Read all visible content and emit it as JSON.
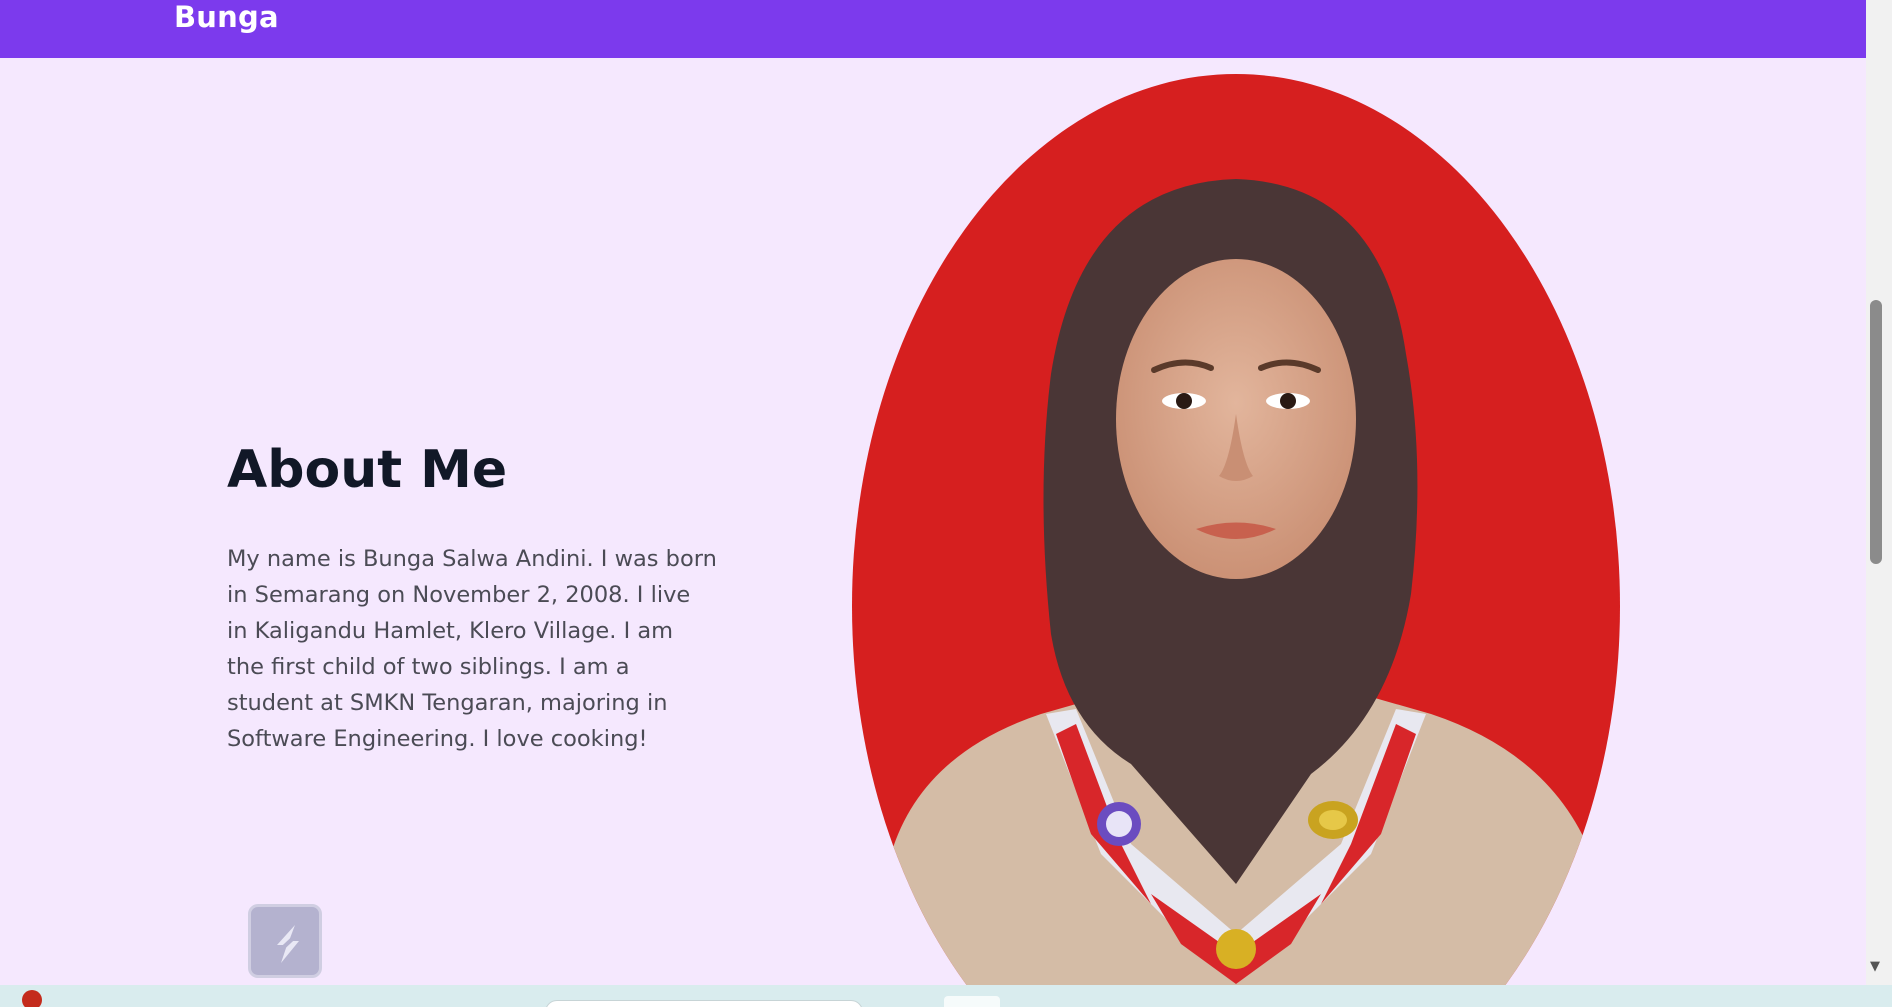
{
  "navbar": {
    "brand": "Bunga",
    "background": "#7c3aed"
  },
  "about": {
    "title": "About Me",
    "text": "My name is Bunga Salwa Andini. I was born in Semarang on November 2, 2008. I live in Kaligandu Hamlet, Klero Village. I am the first child of two siblings. I am a student at SMKN Tengaran, majoring in Software Engineering. I love cooking!"
  },
  "colors": {
    "page_background": "#f5e8fe",
    "portrait_background": "#d61f1f",
    "title": "#111827",
    "body_text": "#4b4b55"
  },
  "floating_button": {
    "icon": "lightning-slash-icon"
  },
  "scrollbar": {
    "down_arrow": "▼"
  }
}
